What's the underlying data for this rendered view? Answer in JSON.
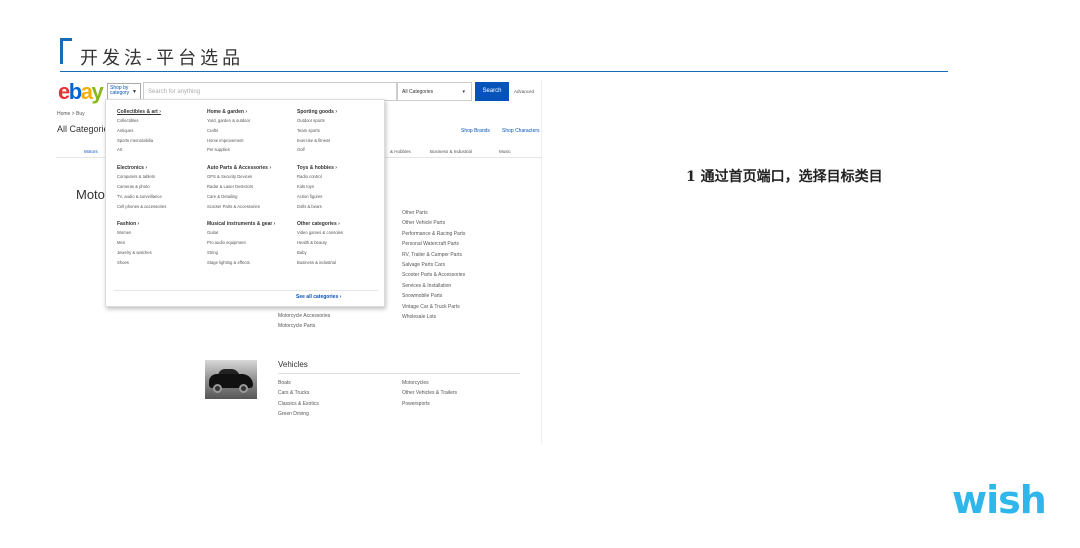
{
  "slide": {
    "title": "开发法-平台选品",
    "step_text": "1  通过首页端口，选择目标类目",
    "logo_text": "wish"
  },
  "ebay": {
    "logo": [
      "e",
      "b",
      "a",
      "y"
    ],
    "shop_by": "Shop by category",
    "search_placeholder": "Search for anything",
    "category_select": "All Categories",
    "search_button": "Search",
    "advanced": "Advanced",
    "breadcrumb": "Home  >  Buy",
    "page_title": "All Categories",
    "shop_brands": "Shop Brands",
    "shop_characters": "Shop Characters",
    "tabs": [
      "Motors",
      "& Hobbies",
      "Business & Industrial",
      "Music"
    ],
    "section_heading": "Motors",
    "right_list": [
      "Other Parts",
      "Other Vehicle Parts",
      "Performance & Racing Parts",
      "Personal Watercraft Parts",
      "RV, Trailer & Camper Parts",
      "Salvage Parts Cars",
      "Scooter Parts & Accessories",
      "Services & Installation",
      "Snowmobile Parts",
      "Vintage Car & Truck Parts",
      "Wholesale Lots"
    ],
    "moto_links": [
      "Motorcycle Accessories",
      "Motorcycle Parts"
    ],
    "vehicles": {
      "title": "Vehicles",
      "col1": [
        "Boats",
        "Cars & Trucks",
        "Classics & Exotics",
        "Green Driving"
      ],
      "col2": [
        "Motorcycles",
        "Other Vehicles & Trailers",
        "Powersports"
      ]
    },
    "mega_menu": {
      "columns": [
        [
          {
            "head": "Collectibles & art ›",
            "items": [
              "Collectibles",
              "Antiques",
              "Sports memorabilia",
              "Art"
            ]
          },
          {
            "head": "Electronics ›",
            "items": [
              "Computers & tablets",
              "Cameras & photo",
              "TV, audio & surveillance",
              "Cell phones & accessories"
            ]
          },
          {
            "head": "Fashion ›",
            "items": [
              "Women",
              "Men",
              "Jewelry & watches",
              "Shoes"
            ]
          }
        ],
        [
          {
            "head": "Home & garden ›",
            "items": [
              "Yard, garden & outdoor",
              "Crafts",
              "Home improvement",
              "Pet supplies"
            ]
          },
          {
            "head": "Auto Parts & Accessories ›",
            "items": [
              "GPS & Security Devices",
              "Radar & Laser Detectors",
              "Care & Detailing",
              "Scooter Parts & Accessories"
            ]
          },
          {
            "head": "Musical instruments & gear ›",
            "items": [
              "Guitar",
              "Pro audio equipment",
              "String",
              "Stage lighting & effects"
            ]
          }
        ],
        [
          {
            "head": "Sporting goods ›",
            "items": [
              "Outdoor sports",
              "Team sports",
              "Exercise & fitness",
              "Golf"
            ]
          },
          {
            "head": "Toys & hobbies ›",
            "items": [
              "Radio control",
              "Kids toys",
              "Action figures",
              "Dolls & bears"
            ]
          },
          {
            "head": "Other categories ›",
            "items": [
              "Video games & consoles",
              "Health & beauty",
              "Baby",
              "Business & industrial"
            ]
          }
        ]
      ],
      "see_all": "See all categories ›"
    }
  },
  "colors": {
    "accent_blue": "#1a6bb5",
    "ebay_blue": "#0654ba",
    "wish_blue": "#2fb7ec"
  }
}
